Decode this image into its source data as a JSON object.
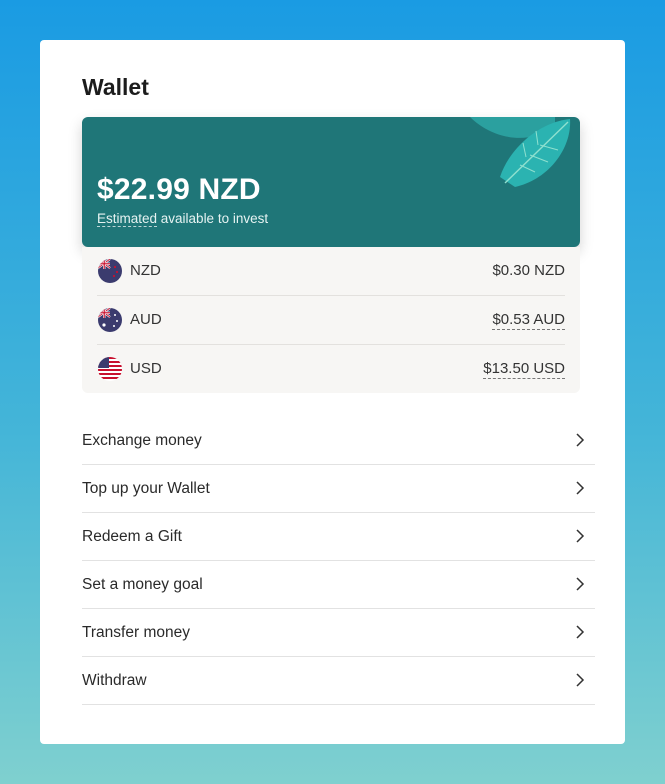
{
  "wallet": {
    "title": "Wallet",
    "total_amount": "$22.99 NZD",
    "subtitle_dashed": "Estimated",
    "subtitle_rest": " available to invest",
    "colors": {
      "hero": "#1f7678",
      "accent_leaf": "#2bb3b1"
    }
  },
  "balances": [
    {
      "currency": "NZD",
      "amount": "$0.30 NZD",
      "flag_icon": "nz-flag-icon"
    },
    {
      "currency": "AUD",
      "amount": "$0.53 AUD",
      "flag_icon": "au-flag-icon"
    },
    {
      "currency": "USD",
      "amount": "$13.50 USD",
      "flag_icon": "us-flag-icon"
    }
  ],
  "menu": [
    {
      "label": "Exchange money"
    },
    {
      "label": "Top up your Wallet"
    },
    {
      "label": "Redeem a Gift"
    },
    {
      "label": "Set a money goal"
    },
    {
      "label": "Transfer money"
    },
    {
      "label": "Withdraw"
    }
  ]
}
